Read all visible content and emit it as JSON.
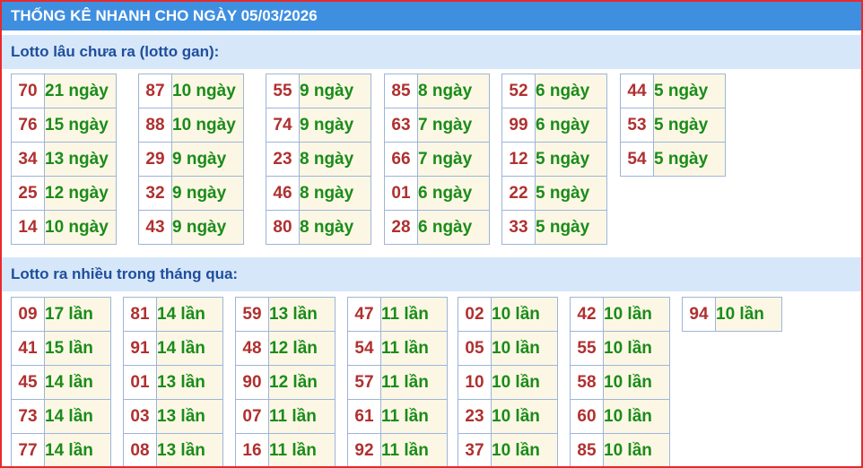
{
  "title": "THỐNG KÊ NHANH CHO NGÀY 05/03/2026",
  "sections": [
    {
      "heading": "Lotto lâu chưa ra (lotto gan):",
      "groups": [
        [
          [
            "70",
            "21 ngày"
          ],
          [
            "76",
            "15 ngày"
          ],
          [
            "34",
            "13 ngày"
          ],
          [
            "25",
            "12 ngày"
          ],
          [
            "14",
            "10 ngày"
          ]
        ],
        [
          [
            "87",
            "10 ngày"
          ],
          [
            "88",
            "10 ngày"
          ],
          [
            "29",
            "9 ngày"
          ],
          [
            "32",
            "9 ngày"
          ],
          [
            "43",
            "9 ngày"
          ]
        ],
        [
          [
            "55",
            "9 ngày"
          ],
          [
            "74",
            "9 ngày"
          ],
          [
            "23",
            "8 ngày"
          ],
          [
            "46",
            "8 ngày"
          ],
          [
            "80",
            "8 ngày"
          ]
        ],
        [
          [
            "85",
            "8 ngày"
          ],
          [
            "63",
            "7 ngày"
          ],
          [
            "66",
            "7 ngày"
          ],
          [
            "01",
            "6 ngày"
          ],
          [
            "28",
            "6 ngày"
          ]
        ],
        [
          [
            "52",
            "6 ngày"
          ],
          [
            "99",
            "6 ngày"
          ],
          [
            "12",
            "5 ngày"
          ],
          [
            "22",
            "5 ngày"
          ],
          [
            "33",
            "5 ngày"
          ]
        ],
        [
          [
            "44",
            "5 ngày"
          ],
          [
            "53",
            "5 ngày"
          ],
          [
            "54",
            "5 ngày"
          ]
        ]
      ]
    },
    {
      "heading": "Lotto ra nhiều trong tháng qua:",
      "groups": [
        [
          [
            "09",
            "17 lần"
          ],
          [
            "41",
            "15 lần"
          ],
          [
            "45",
            "14 lần"
          ],
          [
            "73",
            "14 lần"
          ],
          [
            "77",
            "14 lần"
          ]
        ],
        [
          [
            "81",
            "14 lần"
          ],
          [
            "91",
            "14 lần"
          ],
          [
            "01",
            "13 lần"
          ],
          [
            "03",
            "13 lần"
          ],
          [
            "08",
            "13 lần"
          ]
        ],
        [
          [
            "59",
            "13 lần"
          ],
          [
            "48",
            "12 lần"
          ],
          [
            "90",
            "12 lần"
          ],
          [
            "07",
            "11 lần"
          ],
          [
            "16",
            "11 lần"
          ]
        ],
        [
          [
            "47",
            "11 lần"
          ],
          [
            "54",
            "11 lần"
          ],
          [
            "57",
            "11 lần"
          ],
          [
            "61",
            "11 lần"
          ],
          [
            "92",
            "11 lần"
          ]
        ],
        [
          [
            "02",
            "10 lần"
          ],
          [
            "05",
            "10 lần"
          ],
          [
            "10",
            "10 lần"
          ],
          [
            "23",
            "10 lần"
          ],
          [
            "37",
            "10 lần"
          ]
        ],
        [
          [
            "42",
            "10 lần"
          ],
          [
            "55",
            "10 lần"
          ],
          [
            "58",
            "10 lần"
          ],
          [
            "60",
            "10 lần"
          ],
          [
            "85",
            "10 lần"
          ]
        ],
        [
          [
            "94",
            "10 lần"
          ]
        ]
      ]
    }
  ]
}
